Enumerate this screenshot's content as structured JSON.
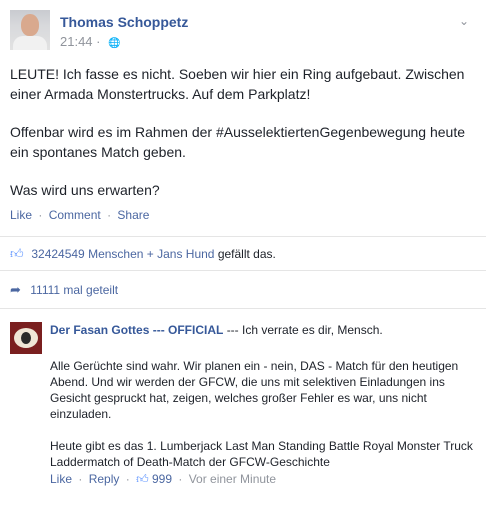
{
  "post": {
    "author": "Thomas Schoppetz",
    "time": "21:44",
    "time_dot": "·",
    "paragraphs": [
      "LEUTE! Ich fasse es nicht. Soeben wir hier ein Ring aufgebaut. Zwischen einer Armada Monstertrucks. Auf dem Parkplatz!",
      "Offenbar wird es im Rahmen der #AusselektiertenGegenbewegung heute ein spontanes Match geben.",
      "Was wird uns erwarten?"
    ],
    "actions": {
      "like": "Like",
      "comment": "Comment",
      "share": "Share",
      "sep": "·"
    }
  },
  "likes": {
    "names": "32424549 Menschen + Jans Hund",
    "suffix": "gefällt das."
  },
  "shares": {
    "label": "11111 mal geteilt"
  },
  "comment": {
    "author": "Der Fasan Gottes --- OFFICIAL",
    "inline_text": "--- Ich verrate es dir, Mensch.",
    "paragraphs": [
      "Alle Gerüchte sind wahr. Wir planen ein - nein, DAS - Match für den heutigen Abend. Und wir werden der GFCW, die uns mit selektiven Einladungen ins Gesicht gespruckt hat, zeigen, welches großer Fehler es war, uns nicht einzuladen.",
      "Heute gibt es das 1. Lumberjack Last Man Standing Battle Royal Monster Truck Laddermatch of Death-Match der GFCW-Geschichte"
    ],
    "actions": {
      "like": "Like",
      "reply": "Reply",
      "like_count": "999",
      "time": "Vor einer Minute",
      "sep": "·"
    }
  },
  "icons": {
    "globe": "globe-icon",
    "chevron": "chevron-down-icon",
    "thumb": "thumbs-up-icon",
    "share": "share-arrow-icon"
  }
}
